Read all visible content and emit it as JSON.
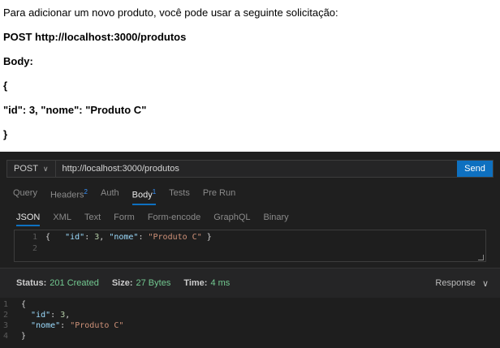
{
  "doc": {
    "intro": "Para adicionar um novo produto, você pode usar a seguinte solicitação:",
    "request_line": "POST http://localhost:3000/produtos",
    "body_label": "Body:",
    "open_brace": "{",
    "body_content": " \"id\": 3, \"nome\": \"Produto C\"",
    "close_brace": "}"
  },
  "client": {
    "method": "POST",
    "url": "http://localhost:3000/produtos",
    "send_label": "Send",
    "tabs": [
      {
        "label": "Query",
        "badge": ""
      },
      {
        "label": "Headers",
        "badge": "2"
      },
      {
        "label": "Auth",
        "badge": ""
      },
      {
        "label": "Body",
        "badge": "1"
      },
      {
        "label": "Tests",
        "badge": ""
      },
      {
        "label": "Pre Run",
        "badge": ""
      }
    ],
    "active_tab": "Body",
    "body_types": [
      "JSON",
      "XML",
      "Text",
      "Form",
      "Form-encode",
      "GraphQL",
      "Binary"
    ],
    "active_body_type": "JSON",
    "editor_lines": [
      {
        "num": "1",
        "open": "{",
        "key1": "\"id\"",
        "val1": "3",
        "key2": "\"nome\"",
        "val2": "\"Produto C\"",
        "close": "}"
      },
      {
        "num": "2"
      }
    ],
    "status": {
      "status_label": "Status:",
      "status_value": "201 Created",
      "size_label": "Size:",
      "size_value": "27 Bytes",
      "time_label": "Time:",
      "time_value": "4 ms"
    },
    "response_select": "Response",
    "response_lines": [
      {
        "num": "1",
        "text": "{"
      },
      {
        "num": "2",
        "key": "\"id\"",
        "value": "3",
        "value_type": "number",
        "trail": ","
      },
      {
        "num": "3",
        "key": "\"nome\"",
        "value": "\"Produto C\"",
        "value_type": "string",
        "trail": ""
      },
      {
        "num": "4",
        "text": "}"
      }
    ]
  }
}
